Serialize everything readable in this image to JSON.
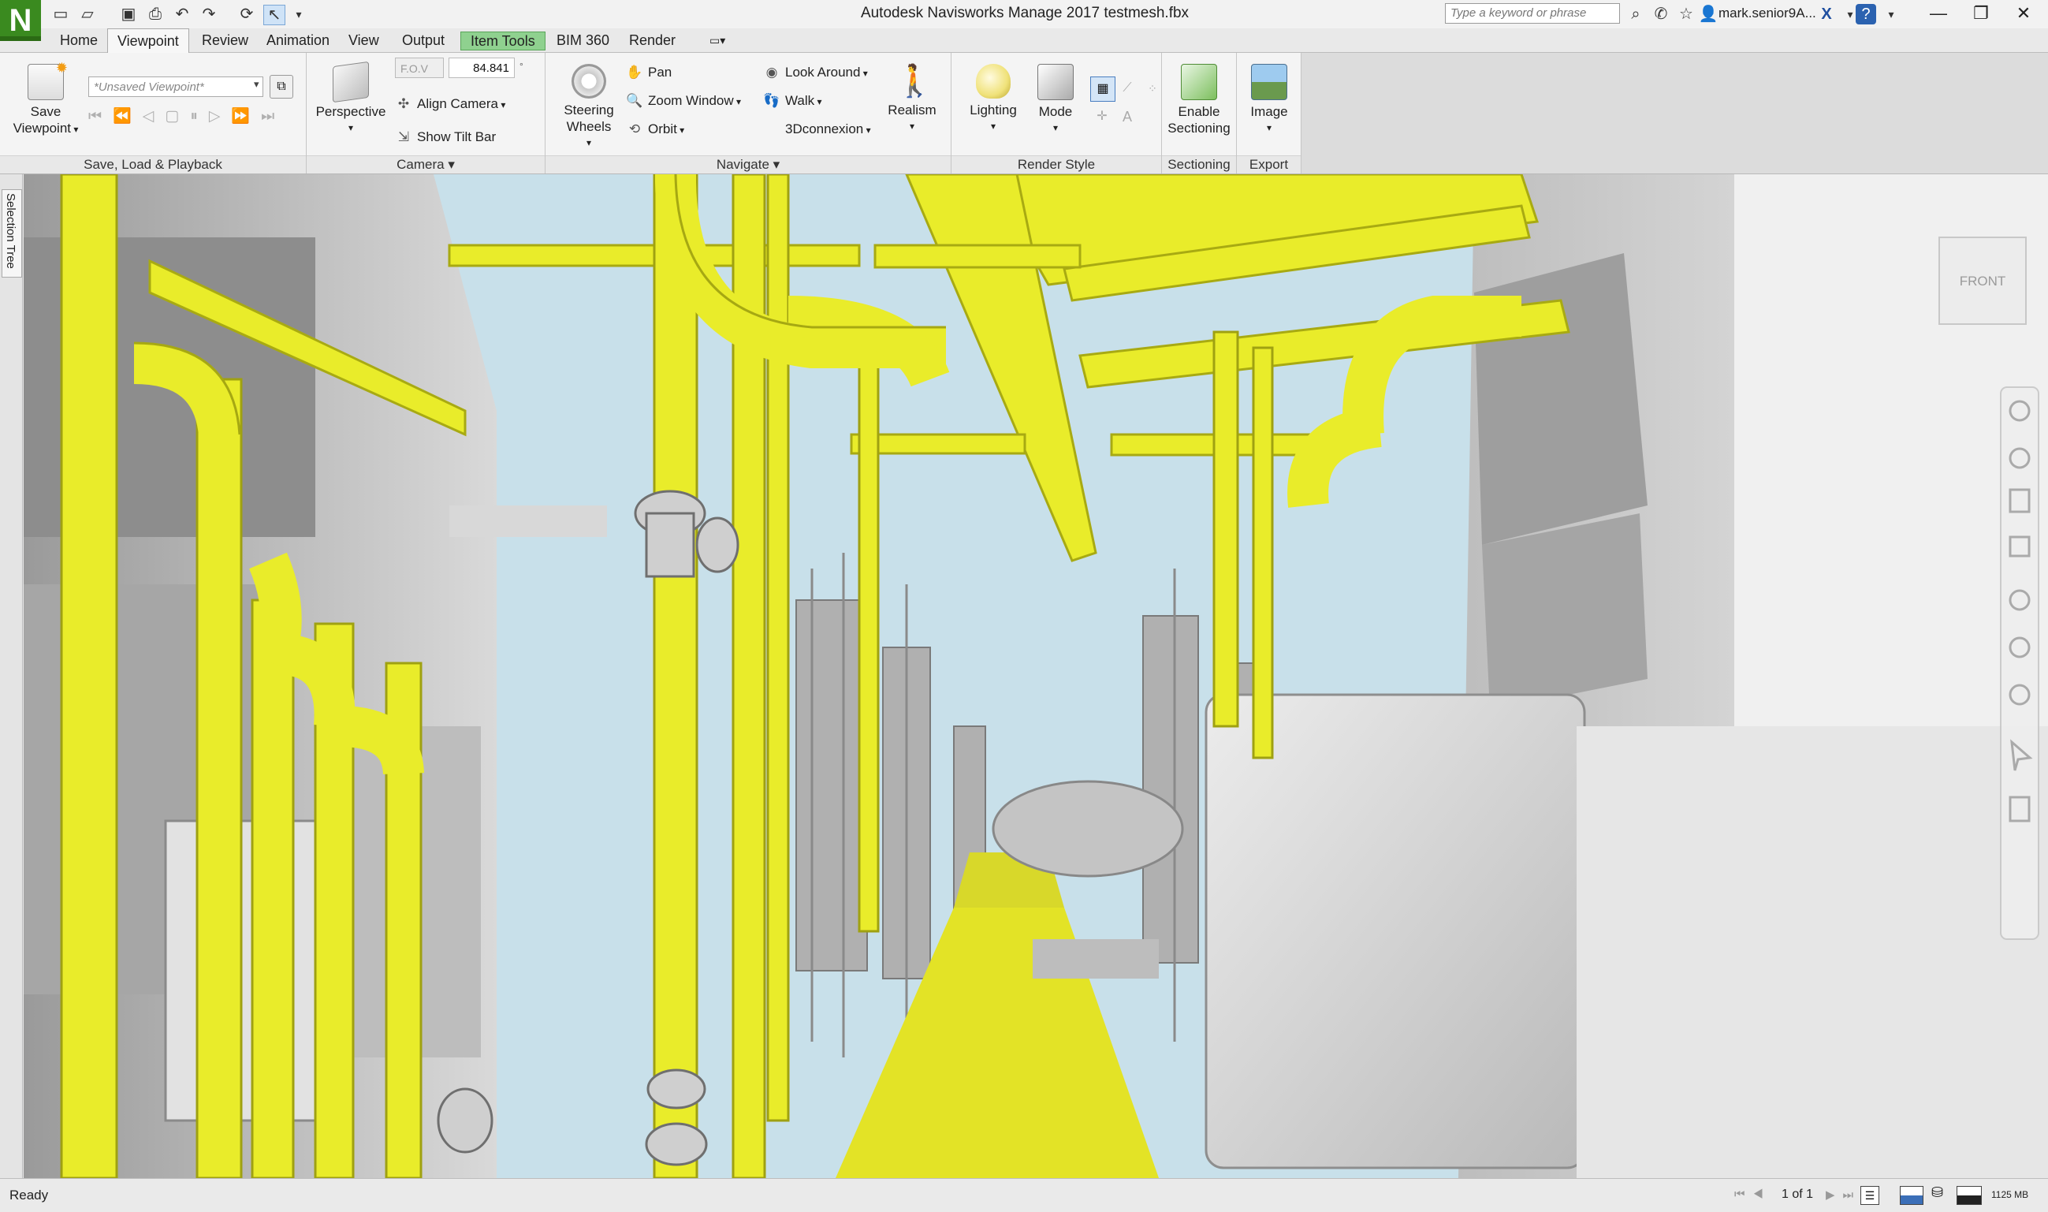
{
  "app": {
    "logo_letter": "N",
    "title": "Autodesk Navisworks Manage 2017   testmesh.fbx",
    "search_placeholder": "Type a keyword or phrase",
    "user": "mark.senior9A...",
    "accent": "#3a8a1f"
  },
  "quick_access": [
    "new-icon",
    "open-icon",
    "save-icon",
    "print-icon",
    "undo-icon",
    "redo-icon",
    "refresh-icon",
    "select-icon",
    "dropdown-icon"
  ],
  "window_buttons": {
    "minimize": "—",
    "restore": "❐",
    "close": "✕"
  },
  "tabs": [
    {
      "label": "Home",
      "active": false
    },
    {
      "label": "Viewpoint",
      "active": true
    },
    {
      "label": "Review",
      "active": false
    },
    {
      "label": "Animation",
      "active": false
    },
    {
      "label": "View",
      "active": false
    },
    {
      "label": "Output",
      "active": false
    },
    {
      "label": "Item Tools",
      "active": false,
      "context": true
    },
    {
      "label": "BIM 360",
      "active": false
    },
    {
      "label": "Render",
      "active": false
    }
  ],
  "ribbon": {
    "save_load": {
      "title": "Save, Load & Playback",
      "save_viewpoint": "Save Viewpoint",
      "viewpoint_value": "*Unsaved Viewpoint*"
    },
    "camera": {
      "title": "Camera",
      "perspective": "Perspective",
      "fov_label": "F.O.V",
      "fov_value": "84.841",
      "align_camera": "Align Camera",
      "show_tilt_bar": "Show Tilt Bar"
    },
    "navigate": {
      "title": "Navigate",
      "steering_wheels": "Steering Wheels",
      "pan": "Pan",
      "zoom_window": "Zoom Window",
      "orbit": "Orbit",
      "look_around": "Look Around",
      "walk": "Walk",
      "3dconnexion": "3Dconnexion",
      "realism": "Realism"
    },
    "render_style": {
      "title": "Render Style",
      "lighting": "Lighting",
      "mode": "Mode"
    },
    "sectioning": {
      "title": "Sectioning",
      "enable_sectioning": "Enable Sectioning"
    },
    "export": {
      "title": "Export",
      "image": "Image"
    }
  },
  "side_tab": "Selection Tree",
  "viewcube_face": "FRONT",
  "status": {
    "text": "Ready",
    "page": "1 of 1",
    "memory": "1125 MB"
  },
  "colors": {
    "pipe_yellow": "#e9ec2a",
    "sky": "#c8e0ea",
    "equipment_gray": "#d6d6d6"
  }
}
